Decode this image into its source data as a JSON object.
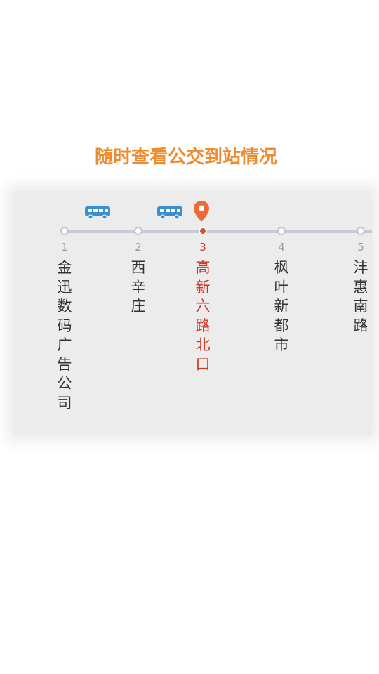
{
  "headline": "随时查看公交到站情况",
  "colors": {
    "accent": "#f08a2c",
    "current_stop": "#d03524",
    "bus_icon": "#3a8fd3",
    "pin": "#f06a36"
  },
  "icons": [
    "bus-icon",
    "bus-icon",
    "location-pin-icon"
  ],
  "stops": [
    {
      "num": "1",
      "name": "金迅数码广告公司",
      "current": false
    },
    {
      "num": "2",
      "name": "西辛庄",
      "current": false
    },
    {
      "num": "3",
      "name": "高新六路北口",
      "current": true
    },
    {
      "num": "4",
      "name": "枫叶新都市",
      "current": false
    },
    {
      "num": "5",
      "name": "沣惠南路",
      "current": false
    }
  ]
}
